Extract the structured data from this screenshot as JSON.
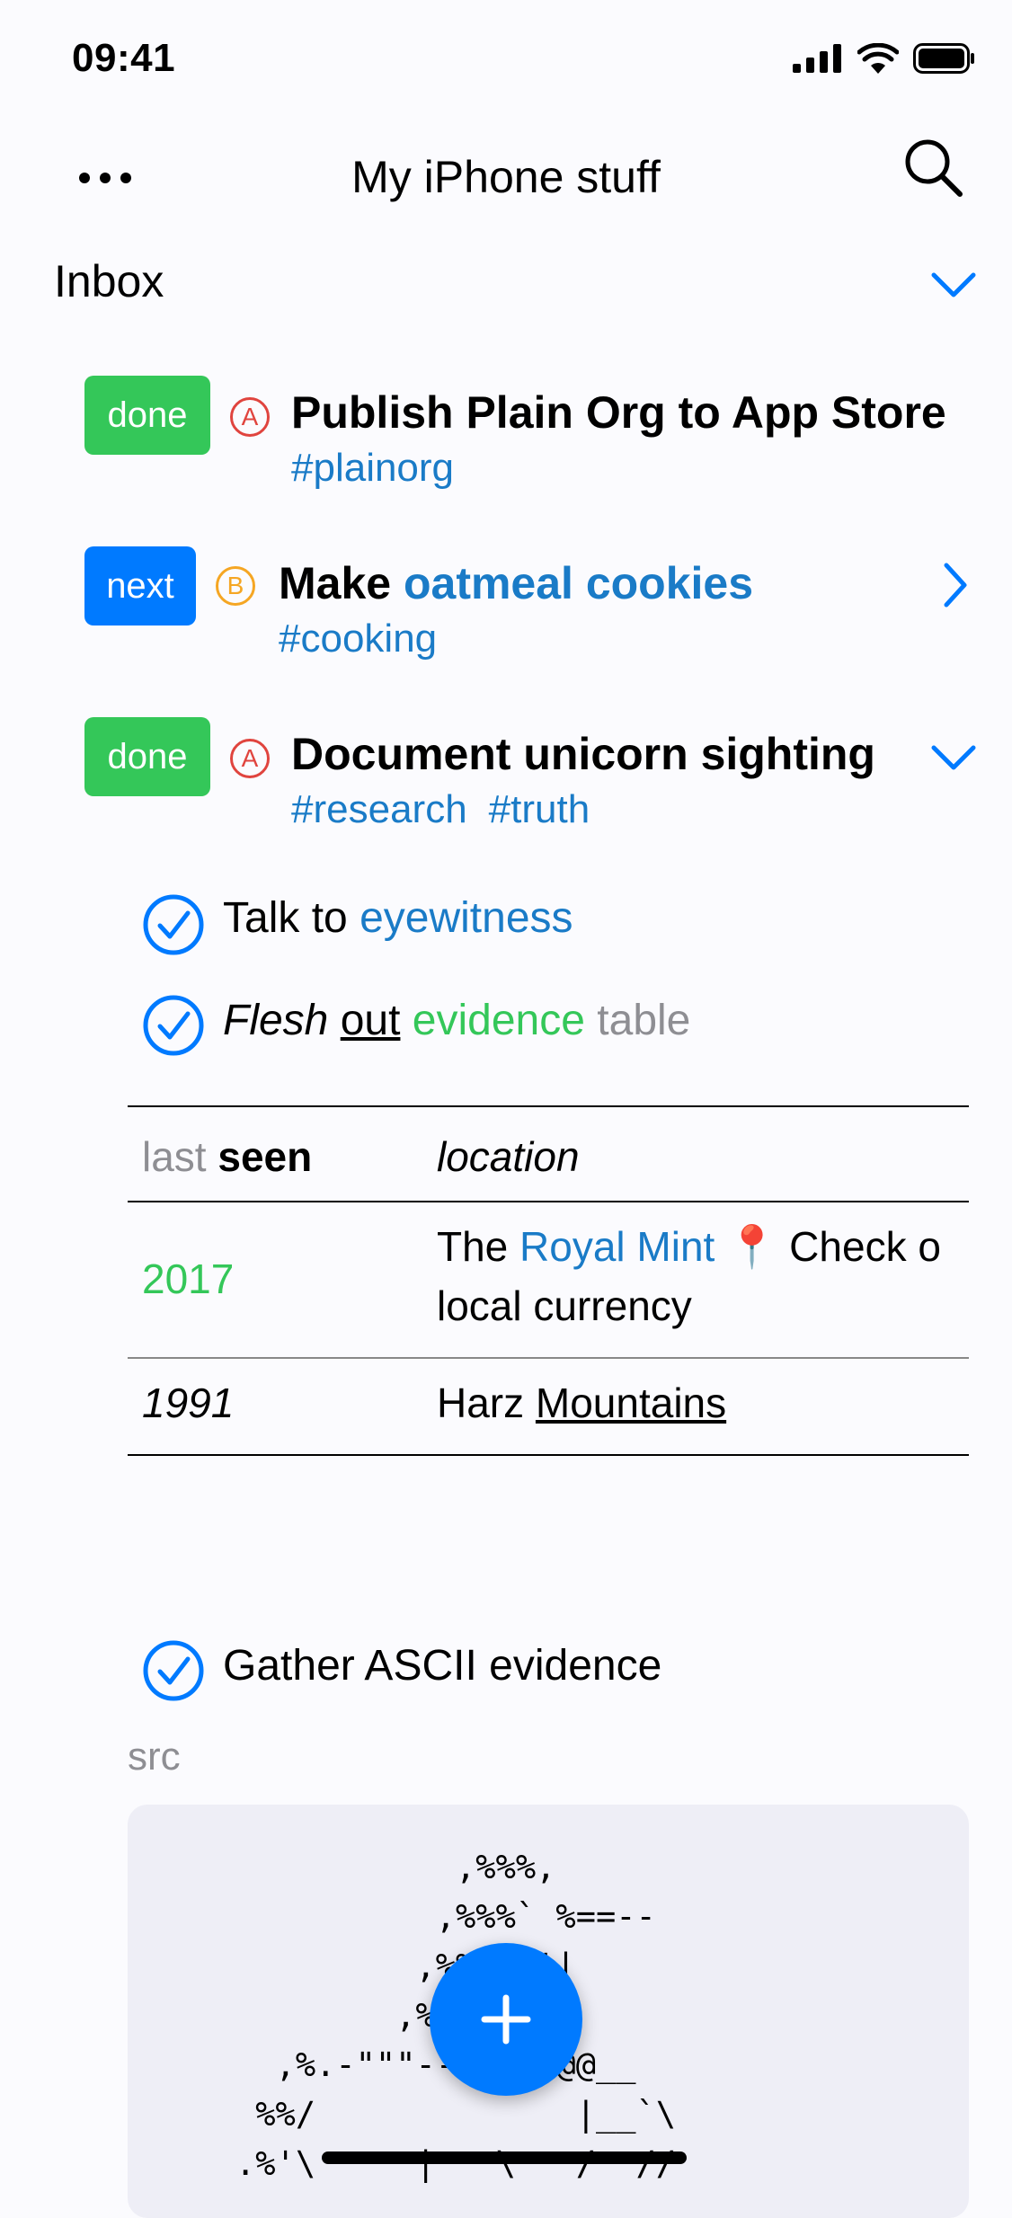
{
  "status": {
    "time": "09:41"
  },
  "nav": {
    "title": "My iPhone stuff"
  },
  "inbox": {
    "title": "Inbox"
  },
  "headings": [
    {
      "state": "done",
      "priority": "A",
      "title": "Publish Plain Org to App Store",
      "tags": [
        "#plainorg"
      ]
    },
    {
      "state": "next",
      "priority": "B",
      "title_prefix": "Make ",
      "title_link": "oatmeal cookies",
      "tags": [
        "#cooking"
      ]
    },
    {
      "state": "done",
      "priority": "A",
      "title": "Document unicorn sighting",
      "tags": [
        "#research",
        "#truth"
      ]
    }
  ],
  "checklist": {
    "item1": {
      "text": "Talk to ",
      "link": "eyewitness"
    },
    "item2": {
      "italic": "Flesh",
      "underline": "out",
      "green": "evidence",
      "gray": "table"
    },
    "item3": {
      "text": "Gather ASCII evidence"
    }
  },
  "table": {
    "header": {
      "col1_gray": "last",
      "col1_bold": "seen",
      "col2": "location"
    },
    "rows": [
      {
        "col1": "2017",
        "col2_pre": "The ",
        "col2_link": "Royal Mint",
        "col2_pin": "📍",
        "col2_post": " Check o",
        "col2_line2": "local currency"
      },
      {
        "col1": "1991",
        "col2_pre": "Harz ",
        "col2_underline": "Mountains"
      }
    ]
  },
  "src": {
    "label": "src",
    "ascii": "           ,%%%,\n          ,%%%` %==--\n         ,%%`( '|\n        ,%%@ /\\_/\n  ,%.-\"\"\"--%%% \"@@__\n %%/             |__`\\\n.%'\\     |   \\   /  //"
  },
  "colors": {
    "accent": "#007aff",
    "done": "#34c759",
    "tag": "#1a7bc7",
    "prioA": "#e0443e",
    "prioB": "#f5a623"
  }
}
